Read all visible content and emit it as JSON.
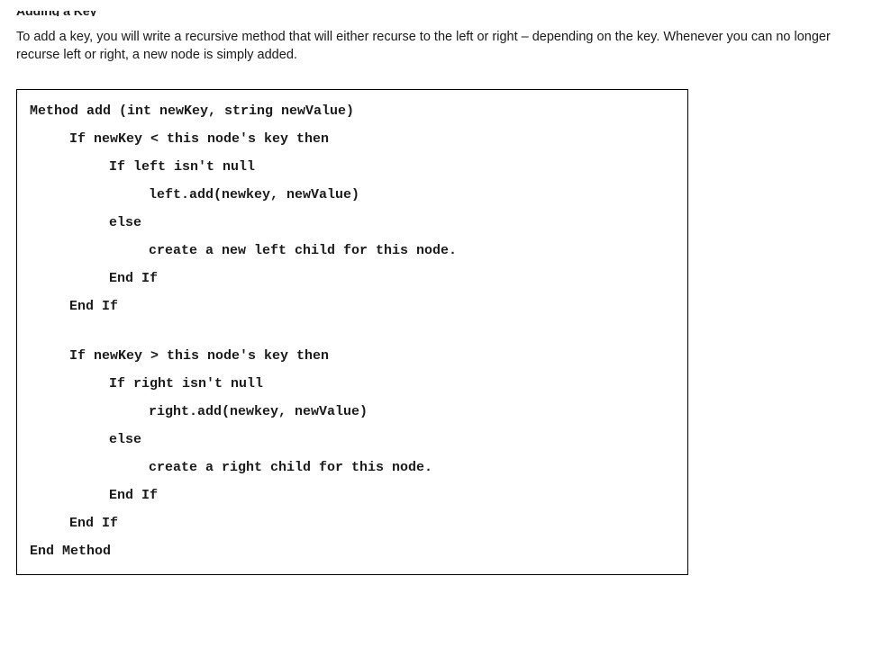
{
  "header": {
    "title_fragment": "Adding a Key",
    "paragraph": "To add a key, you will write a recursive method that will either recurse to the left or right – depending on the key. Whenever you can no longer recurse left or right, a new node is simply added."
  },
  "code": {
    "l1": "Method add (int newKey, string newValue)",
    "l2": "If newKey < this node's key then",
    "l3": "If left isn't null",
    "l4": "left.add(newkey, newValue)",
    "l5": "else",
    "l6": "create a new left child for this node.",
    "l7": "End If",
    "l8": "End If",
    "l9": "If newKey > this node's key then",
    "l10": "If right isn't null",
    "l11": "right.add(newkey, newValue)",
    "l12": "else",
    "l13": "create a right child for this node.",
    "l14": "End If",
    "l15": "End If",
    "l16": "End Method"
  }
}
